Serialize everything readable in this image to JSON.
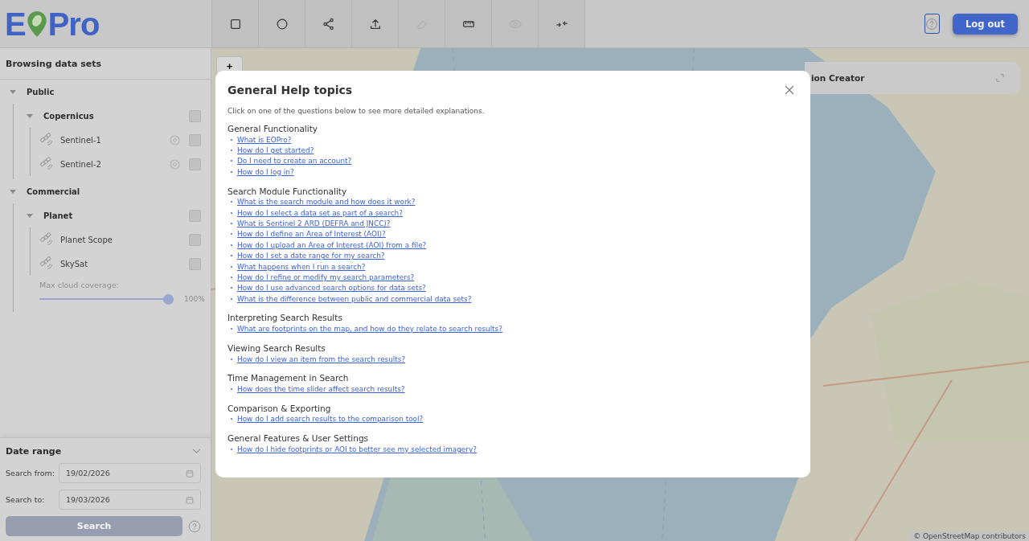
{
  "logo": {
    "before_icon": "E",
    "after_icon": "Pro"
  },
  "toolbar": [
    {
      "kind": "rectangle",
      "disabled": false
    },
    {
      "kind": "circle",
      "disabled": false
    },
    {
      "kind": "share",
      "disabled": false
    },
    {
      "kind": "upload",
      "disabled": false
    },
    {
      "kind": "eraser",
      "disabled": true
    },
    {
      "kind": "ruler",
      "disabled": false
    },
    {
      "kind": "eye",
      "disabled": true
    },
    {
      "kind": "collapse",
      "disabled": false
    }
  ],
  "logout_button": "Log out",
  "sidebar": {
    "title": "Browsing data sets",
    "tree": [
      {
        "label": "Public",
        "expanded": true,
        "children": [
          {
            "label": "Copernicus",
            "expanded": true,
            "checked": false,
            "children": [
              {
                "label": "Sentinel-1",
                "settings": true,
                "checked": false
              },
              {
                "label": "Sentinel-2",
                "settings": true,
                "checked": false
              }
            ]
          }
        ]
      },
      {
        "label": "Commercial",
        "expanded": true,
        "children": [
          {
            "label": "Planet",
            "expanded": true,
            "checked": false,
            "children": [
              {
                "label": "Planet Scope",
                "settings": false,
                "checked": false
              },
              {
                "label": "SkySat",
                "settings": false,
                "checked": false
              }
            ]
          }
        ],
        "slider": {
          "label": "Max cloud coverage:",
          "level": 1,
          "reading": "100%",
          "disabled": true
        }
      }
    ]
  },
  "date_range": {
    "title": "Date range",
    "expanded": true,
    "fields": [
      {
        "label": "Search from:",
        "value": "19/02/2026"
      },
      {
        "label": "Search to:",
        "value": "19/03/2026"
      }
    ],
    "search_button": {
      "label": "Search",
      "disabled": true
    }
  },
  "map": {
    "zoom_in": "+",
    "panel": {
      "title": "ion Creator"
    },
    "attribution": "© OpenStreetMap contributors"
  },
  "help_dialog": {
    "title": "General Help topics",
    "intro": "Click on one of the questions below to see more detailed explanations.",
    "sections": [
      {
        "heading": "General Functionality",
        "links": [
          "What is EOPro?",
          "How do I get started?",
          "Do I need to create an account?",
          "How do I log in?"
        ]
      },
      {
        "heading": "Search Module Functionality",
        "links": [
          "What is the search module and how does it work?",
          "How do I select a data set as part of a search?",
          "What is Sentinel 2 ARD (DEFRA and JNCC)?",
          "How do I define an Area of Interest (AOI)?",
          "How do I upload an Area of Interest (AOI) from a file?",
          "How do I set a date range for my search?",
          "What happens when I run a search?",
          "How do I refine or modify my search parameters?",
          "How do I use advanced search options for data sets?",
          "What is the difference between public and commercial data sets?"
        ]
      },
      {
        "heading": "Interpreting Search Results",
        "links": [
          "What are footprints on the map, and how do they relate to search results?"
        ]
      },
      {
        "heading": "Viewing Search Results",
        "links": [
          "How do I view an item from the search results?"
        ]
      },
      {
        "heading": "Time Management in Search",
        "links": [
          "How does the time slider affect search results?"
        ]
      },
      {
        "heading": "Comparison & Exporting",
        "links": [
          "How do I add search results to the comparison tool?"
        ]
      },
      {
        "heading": "General Features & User Settings",
        "links": [
          "How do I hide footprints or AOI to better see my selected imagery?"
        ]
      }
    ]
  }
}
